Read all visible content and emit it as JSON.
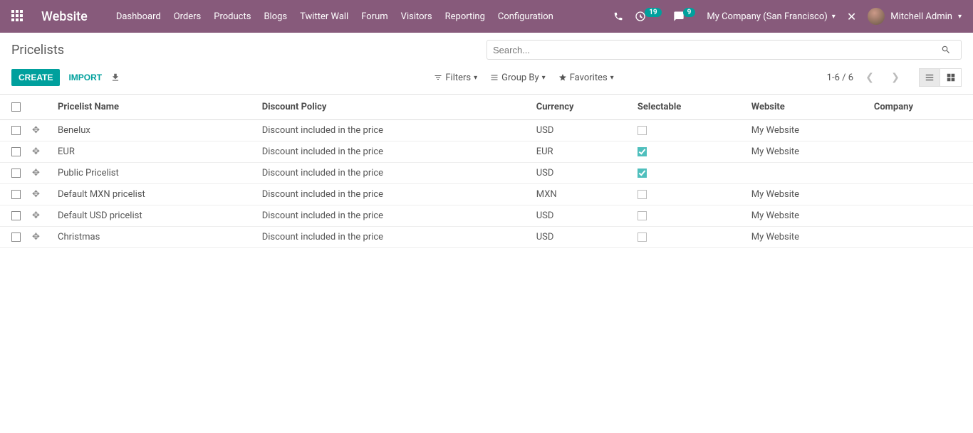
{
  "header": {
    "brand": "Website",
    "nav": [
      "Dashboard",
      "Orders",
      "Products",
      "Blogs",
      "Twitter Wall",
      "Forum",
      "Visitors",
      "Reporting",
      "Configuration"
    ],
    "activity_count": "19",
    "message_count": "9",
    "company": "My Company (San Francisco)",
    "user": "Mitchell Admin"
  },
  "page": {
    "title": "Pricelists",
    "search_placeholder": "Search...",
    "create_label": "CREATE",
    "import_label": "IMPORT",
    "filters_label": "Filters",
    "groupby_label": "Group By",
    "favorites_label": "Favorites",
    "pager": "1-6 / 6"
  },
  "table": {
    "columns": {
      "name": "Pricelist Name",
      "policy": "Discount Policy",
      "currency": "Currency",
      "selectable": "Selectable",
      "website": "Website",
      "company": "Company"
    },
    "rows": [
      {
        "name": "Benelux",
        "policy": "Discount included in the price",
        "currency": "USD",
        "selectable": false,
        "website": "My Website",
        "company": ""
      },
      {
        "name": "EUR",
        "policy": "Discount included in the price",
        "currency": "EUR",
        "selectable": true,
        "website": "My Website",
        "company": ""
      },
      {
        "name": "Public Pricelist",
        "policy": "Discount included in the price",
        "currency": "USD",
        "selectable": true,
        "website": "",
        "company": ""
      },
      {
        "name": "Default MXN pricelist",
        "policy": "Discount included in the price",
        "currency": "MXN",
        "selectable": false,
        "website": "My Website",
        "company": ""
      },
      {
        "name": "Default USD pricelist",
        "policy": "Discount included in the price",
        "currency": "USD",
        "selectable": false,
        "website": "My Website",
        "company": ""
      },
      {
        "name": "Christmas",
        "policy": "Discount included in the price",
        "currency": "USD",
        "selectable": false,
        "website": "My Website",
        "company": ""
      }
    ]
  }
}
